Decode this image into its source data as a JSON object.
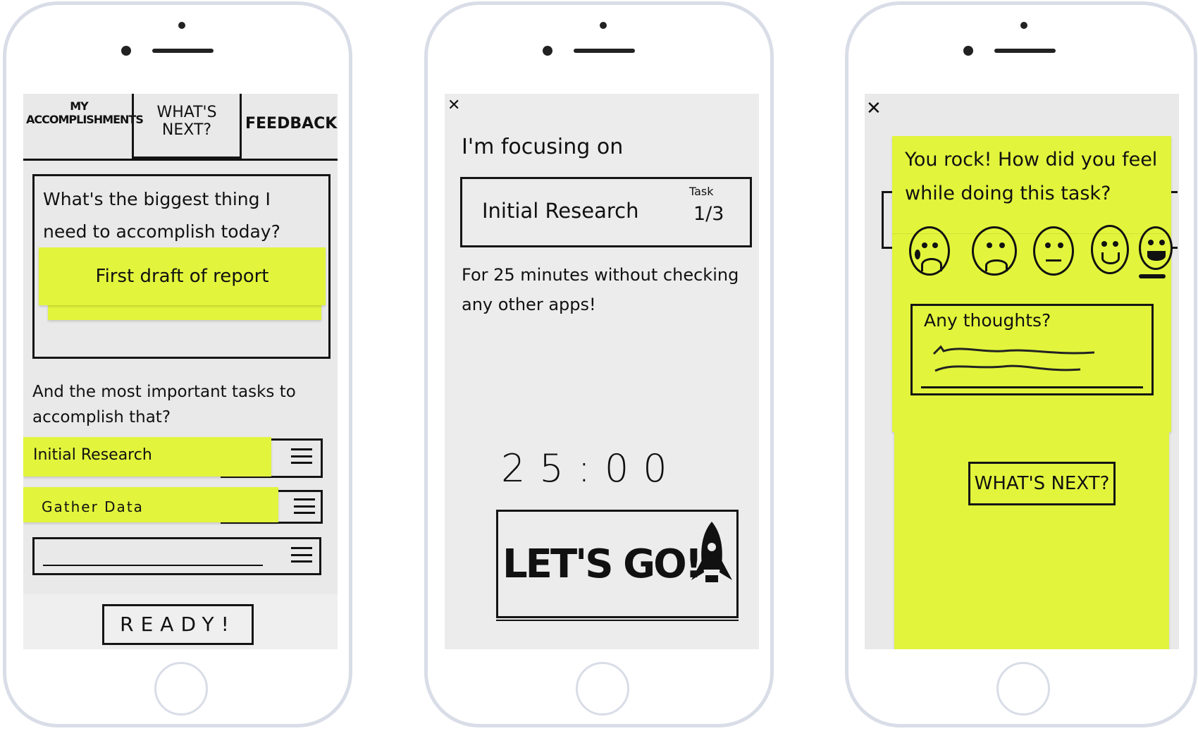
{
  "colors": {
    "sticky": "#e2f53c",
    "paper": "#e9e9ea",
    "frame": "#d9dde7"
  },
  "screen1": {
    "tabs": [
      "MY ACCOMPLISHMENTS",
      "WHAT'S NEXT?",
      "FEEDBACK"
    ],
    "selected_tab": "WHAT'S NEXT?",
    "question": "What's the biggest thing I need to accomplish today?",
    "goal": "First draft of report",
    "subquestion": "And the most important tasks to accomplish that?",
    "tasks": [
      "Initial Research",
      "Gather Data",
      ""
    ],
    "ready": "READY!"
  },
  "screen2": {
    "close": "✕",
    "heading": "I'm focusing on",
    "task": "Initial Research",
    "task_label": "Task",
    "task_count": "1/3",
    "instruction": "For 25 minutes without checking any other apps!",
    "timer": "25:00",
    "go": "LET'S GO!",
    "go_icon": "rocket-icon"
  },
  "screen3": {
    "close": "✕",
    "question": "You rock! How did you feel while doing this task?",
    "moods": [
      "very-sad",
      "sad",
      "neutral",
      "happy",
      "very-happy"
    ],
    "selected_mood": "very-happy",
    "thoughts_label": "Any thoughts?",
    "next": "WHAT'S NEXT?"
  }
}
